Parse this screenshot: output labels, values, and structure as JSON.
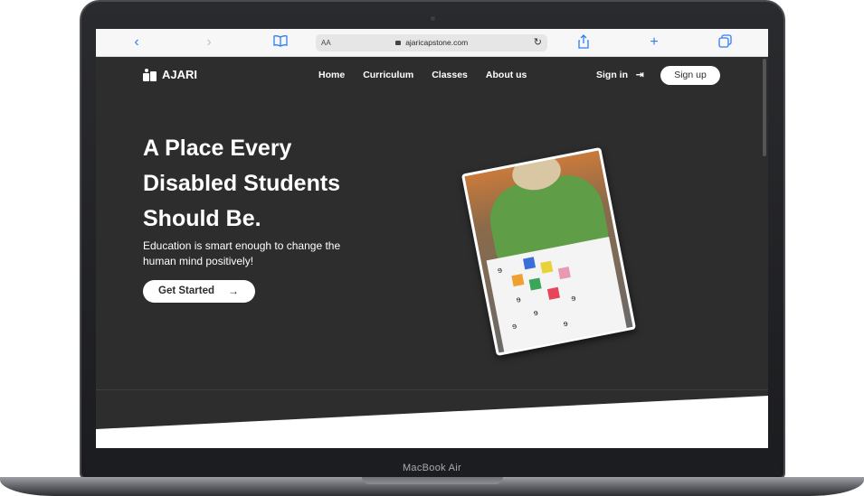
{
  "device": {
    "model_label": "MacBook Air"
  },
  "browser": {
    "url": "ajaricapstone.com",
    "text_size_label": "AA",
    "colors": {
      "accent": "#2f7df6",
      "disabled": "#c3c3c3"
    }
  },
  "site": {
    "brand": "AJARI",
    "nav": [
      {
        "label": "Home"
      },
      {
        "label": "Curriculum"
      },
      {
        "label": "Classes"
      },
      {
        "label": "About us"
      }
    ],
    "signin_label": "Sign in",
    "signup_label": "Sign up",
    "hero": {
      "title_lines": [
        "A Place Every",
        "Disabled Students",
        "Should Be."
      ],
      "subtitle_lines": [
        "Education is smart enough to change the",
        "human mind positively!"
      ],
      "cta_label": "Get Started"
    },
    "colors": {
      "background": "#2d2d2d",
      "text": "#ffffff"
    }
  },
  "icons": {
    "back": "chevron-left-icon",
    "forward": "chevron-right-icon",
    "reader": "book-icon",
    "lock": "lock-icon",
    "reload": "reload-icon",
    "share": "share-icon",
    "new_tab": "plus-icon",
    "tabs": "tabs-icon",
    "signin": "sign-in-icon",
    "cta": "arrow-right-icon"
  }
}
